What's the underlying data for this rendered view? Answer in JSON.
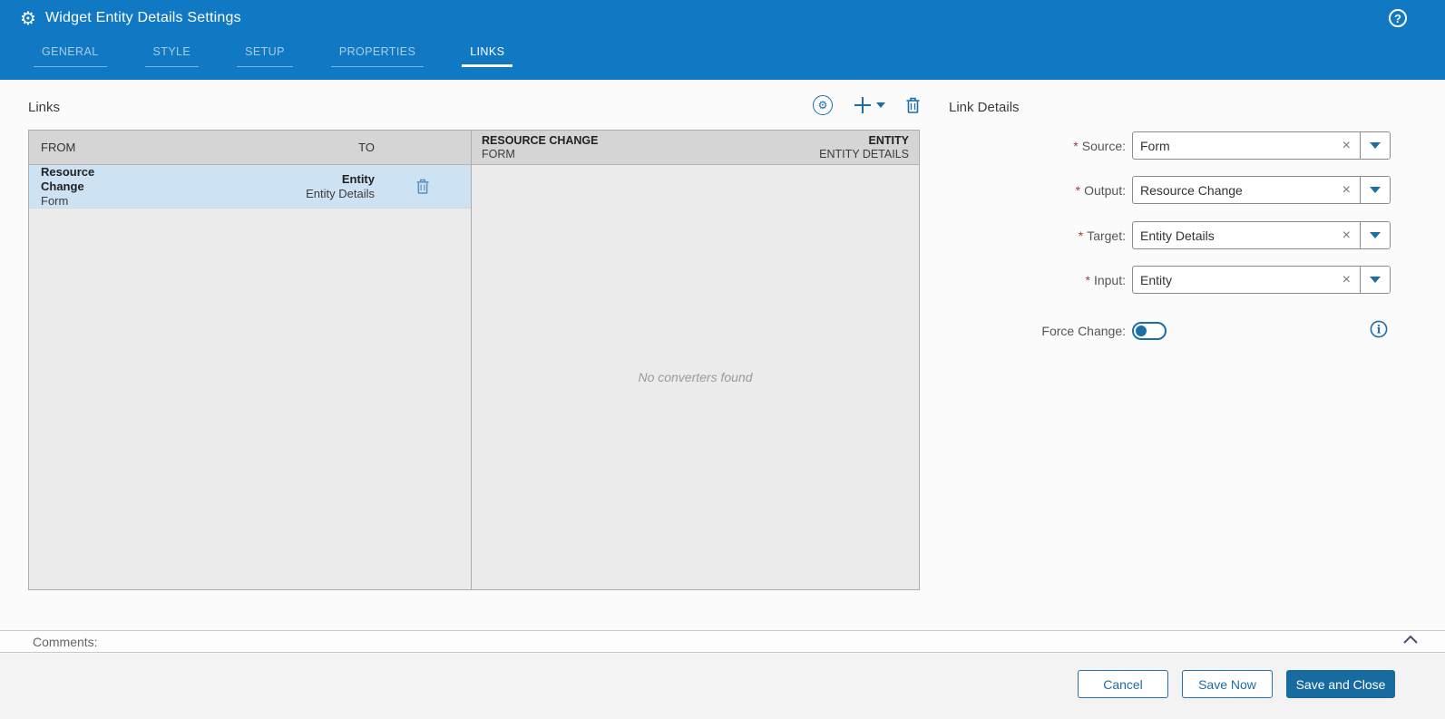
{
  "header": {
    "title": "Widget Entity Details Settings",
    "tabs": [
      {
        "label": "GENERAL",
        "active": false
      },
      {
        "label": "STYLE",
        "active": false
      },
      {
        "label": "SETUP",
        "active": false
      },
      {
        "label": "PROPERTIES",
        "active": false
      },
      {
        "label": "LINKS",
        "active": true
      }
    ],
    "help_label": "?"
  },
  "links_panel": {
    "title": "Links",
    "table": {
      "columns": [
        "FROM",
        "TO"
      ],
      "rows": [
        {
          "from_primary": "Resource Change",
          "from_secondary": "Form",
          "to_primary": "Entity",
          "to_secondary": "Entity Details",
          "selected": true
        }
      ]
    }
  },
  "converters_panel": {
    "from_title": "RESOURCE CHANGE",
    "from_subtitle": "FORM",
    "to_title": "ENTITY",
    "to_subtitle": "ENTITY DETAILS",
    "empty_message": "No converters found"
  },
  "link_details": {
    "title": "Link Details",
    "required_marker": "*",
    "fields": [
      {
        "label": "Source:",
        "required": true,
        "value": "Form"
      },
      {
        "label": "Output:",
        "required": true,
        "value": "Resource Change"
      },
      {
        "label": "Target:",
        "required": true,
        "value": "Entity Details"
      },
      {
        "label": "Input:",
        "required": true,
        "value": "Entity"
      }
    ],
    "clear_glyph": "×",
    "force_change_label": "Force Change:",
    "force_change_on": false
  },
  "comments": {
    "label": "Comments:"
  },
  "footer": {
    "buttons": [
      {
        "label": "Cancel",
        "style": "outline"
      },
      {
        "label": "Save Now",
        "style": "outline"
      },
      {
        "label": "Save and Close",
        "style": "primary"
      }
    ]
  },
  "colors": {
    "header_blue": "#1179c4",
    "primary_button_blue": "#176b9e",
    "icon_blue": "#1c6da6",
    "selected_row_blue": "#cde2f3",
    "panel_gray": "#ebebeb",
    "table_header_gray": "#d5d5d5",
    "required_red": "#a33c39"
  }
}
